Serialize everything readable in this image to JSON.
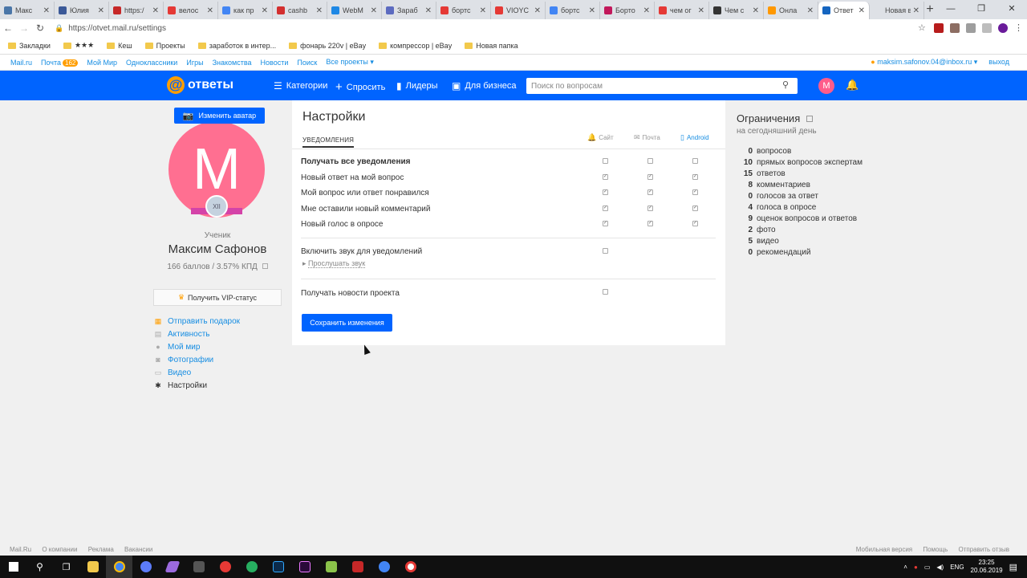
{
  "browser": {
    "tabs": [
      {
        "label": "Макс",
        "color": "#4a76a8"
      },
      {
        "label": "Юлия",
        "color": "#3b5998"
      },
      {
        "label": "https:/",
        "color": "#c62828"
      },
      {
        "label": "велос",
        "color": "#e53935"
      },
      {
        "label": "как пр",
        "color": "#4285f4"
      },
      {
        "label": "cashb",
        "color": "#d32f2f"
      },
      {
        "label": "WebM",
        "color": "#1e88e5"
      },
      {
        "label": "Зараб",
        "color": "#5c6bc0"
      },
      {
        "label": "бортс",
        "color": "#e53935"
      },
      {
        "label": "VIOYC",
        "color": "#e53935"
      },
      {
        "label": "бортс",
        "color": "#4285f4"
      },
      {
        "label": "Борто",
        "color": "#c2185b"
      },
      {
        "label": "чем ог",
        "color": "#e53935"
      },
      {
        "label": "Чем с",
        "color": "#333333"
      },
      {
        "label": "Онла",
        "color": "#ff9800"
      },
      {
        "label": "Ответ",
        "color": "#1565c0"
      },
      {
        "label": "Новая вкл",
        "color": "#dee1e6"
      }
    ],
    "url": "https://otvet.mail.ru/settings",
    "bookmarks": [
      "Закладки",
      "★★★",
      "Кеш",
      "Проекты",
      "заработок в интер...",
      "фонарь 220v | eBay",
      "компрессор | eBay",
      "Новая папка"
    ]
  },
  "mailbar": {
    "links": [
      "Mail.ru",
      "Почта",
      "Мой Мир",
      "Одноклассники",
      "Игры",
      "Знакомства",
      "Новости",
      "Поиск",
      "Все проекты ▾"
    ],
    "mail_count": "162",
    "account": "maksim.safonov.04@inbox.ru ▾",
    "logout": "выход"
  },
  "header": {
    "logo": "ответы",
    "nav": [
      "Категории",
      "Спросить",
      "Лидеры",
      "Для бизнеса"
    ],
    "search_placeholder": "Поиск по вопросам",
    "avatar_letter": "М"
  },
  "profile": {
    "change_avatar": "Изменить аватар",
    "avatar_letter": "M",
    "rank_badge": "XII",
    "title": "Ученик",
    "name": "Максим Сафонов",
    "points": "166 баллов / 3.57% КПД",
    "vip": "Получить VIP-статус",
    "menu": [
      "Отправить подарок",
      "Активность",
      "Мой мир",
      "Фотографии",
      "Видео",
      "Настройки"
    ]
  },
  "settings": {
    "title": "Настройки",
    "tab": "УВЕДОМЛЕНИЯ",
    "columns": [
      "Сайт",
      "Почта",
      "Android"
    ],
    "rows": [
      {
        "label": "Получать все уведомления",
        "checks": [
          false,
          false,
          false
        ]
      },
      {
        "label": "Новый ответ на мой вопрос",
        "checks": [
          true,
          true,
          true
        ]
      },
      {
        "label": "Мой вопрос или ответ понравился",
        "checks": [
          true,
          true,
          true
        ]
      },
      {
        "label": "Мне оставили новый комментарий",
        "checks": [
          true,
          true,
          true
        ]
      },
      {
        "label": "Новый голос в опросе",
        "checks": [
          true,
          true,
          true
        ]
      }
    ],
    "sound_label": "Включить звук для уведомлений",
    "listen_label": "Прослушать звук",
    "news_label": "Получать новости проекта",
    "save_label": "Сохранить изменения"
  },
  "limits": {
    "title": "Ограничения",
    "subtitle": "на сегодняшний день",
    "items": [
      {
        "n": "0",
        "label": "вопросов"
      },
      {
        "n": "10",
        "label": "прямых вопросов экспертам"
      },
      {
        "n": "15",
        "label": "ответов"
      },
      {
        "n": "8",
        "label": "комментариев"
      },
      {
        "n": "0",
        "label": "голосов за ответ"
      },
      {
        "n": "4",
        "label": "голоса в опросе"
      },
      {
        "n": "9",
        "label": "оценок вопросов и ответов"
      },
      {
        "n": "2",
        "label": "фото"
      },
      {
        "n": "5",
        "label": "видео"
      },
      {
        "n": "0",
        "label": "рекомендаций"
      }
    ]
  },
  "footer": {
    "left": [
      "Mail.Ru",
      "О компании",
      "Реклама",
      "Вакансии"
    ],
    "right": [
      "Мобильная версия",
      "Помощь",
      "Отправить отзыв"
    ]
  },
  "taskbar": {
    "lang": "ENG",
    "time": "23:25",
    "date": "20.06.2019"
  }
}
